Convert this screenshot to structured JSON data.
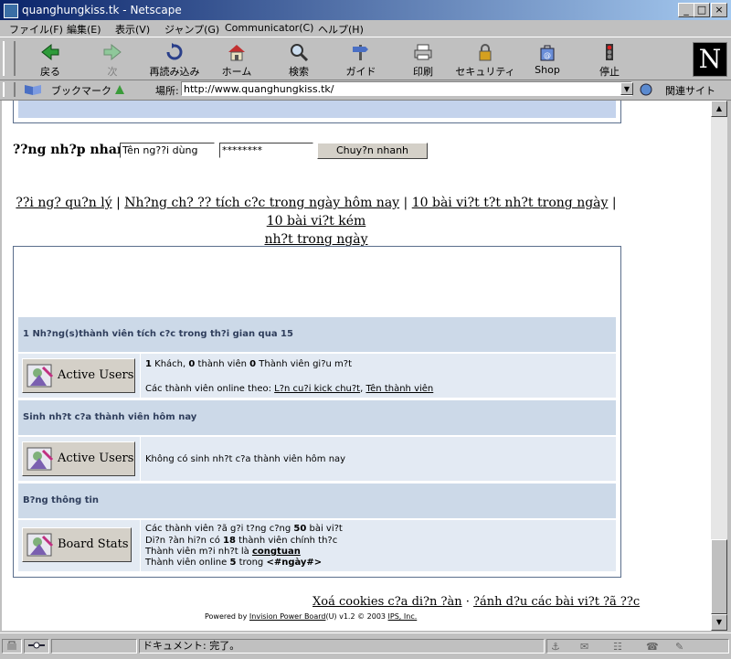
{
  "window": {
    "title": "quanghungkiss.tk - Netscape"
  },
  "menu": [
    "ファイル(F)",
    "編集(E)",
    "表示(V)",
    "ジャンプ(G)",
    "Communicator(C)",
    "ヘルプ(H)"
  ],
  "toolbar": {
    "back": "戻る",
    "forward": "次",
    "reload": "再読み込み",
    "home": "ホーム",
    "search": "検索",
    "guide": "ガイド",
    "print": "印刷",
    "security": "セキュリティ",
    "shop": "Shop",
    "stop": "停止"
  },
  "logo": "N",
  "location": {
    "bookmarks": "ブックマーク",
    "label": "場所:",
    "url": "http://www.quanghungkiss.tk/",
    "related": "関連サイト"
  },
  "quick_login": {
    "label": "??ng nh?p nhanh",
    "username": "Tên ng??i dùng",
    "password": "********",
    "button": "Chuy?n nhanh"
  },
  "nav_links": {
    "l1": "??i ng? qu?n lý",
    "l2": "Nh?ng ch? ?? tích c?c trong ngày hôm nay",
    "l3": "10 bài vi?t t?t nh?t trong ngày",
    "l4a": "10 bài vi?t kém",
    "l4b": "nh?t trong ngày",
    "sep": "|"
  },
  "sections": {
    "active": {
      "title": "1 Nh?ng(s)thành viên tích c?c trong th?i gian qua 15",
      "button": "Active Users",
      "guests_n": "1",
      "guests_t": " Khách, ",
      "members_n": "0",
      "members_t": " thành viên ",
      "hidden_n": "0",
      "hidden_t": " Thành viên gi?u m?t",
      "online_by": "Các thành viên online theo: ",
      "link1": "L?n cu?i kick chu?t",
      "comma": ", ",
      "link2": "Tên thành viên "
    },
    "birthday": {
      "title": "Sinh nh?t c?a thành viên hôm nay",
      "button": "Active Users",
      "text": "Không có sinh nh?t c?a thành viên hôm nay"
    },
    "stats": {
      "title": "B?ng thông tin",
      "button": "Board Stats",
      "l1a": "Các thành viên ?ã g?i t?ng c?ng ",
      "l1n": "50",
      "l1b": " bài vi?t",
      "l2a": "Di?n ?àn hi?n có ",
      "l2n": "18",
      "l2b": " thành viên chính th?c",
      "l3a": "Thành viên m?i nh?t là ",
      "l3l": "congtuan",
      "l4a": "Thành viên online ",
      "l4n": "5",
      "l4b": " trong ",
      "l4c": "<#ngày#>"
    }
  },
  "footer": {
    "link1": "Xoá cookies c?a di?n ?àn",
    "dot": " · ",
    "link2": "?ánh d?u các bài vi?t ?ã ??c",
    "powered_a": "Powered by ",
    "powered_l": "Invision Power Board",
    "powered_b": "(U) v1.2 © 2003  ",
    "powered_l2": "IPS, Inc."
  },
  "status": {
    "text": "ドキュメント: 完了。"
  },
  "colors": {
    "title_bar": "#0a246a",
    "section_header": "#ccd9e8",
    "row_bg": "#e3eaf3",
    "border": "#5a6e8c"
  }
}
